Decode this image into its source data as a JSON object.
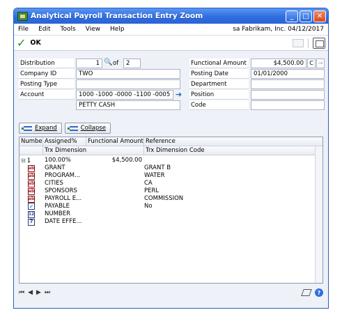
{
  "window": {
    "title": "Analytical Payroll Transaction Entry Zoom"
  },
  "menu": {
    "items": [
      "File",
      "Edit",
      "Tools",
      "View",
      "Help"
    ],
    "context": "sa  Fabrikam, Inc.  04/12/2017"
  },
  "toolbar": {
    "ok_label": "OK"
  },
  "fields": {
    "distribution": {
      "label": "Distribution",
      "value": "1",
      "of_label": "of",
      "total": "2"
    },
    "company_id": {
      "label": "Company ID",
      "value": "TWO"
    },
    "posting_type": {
      "label": "Posting Type",
      "value": ""
    },
    "account": {
      "label": "Account",
      "value": "1000 -1000 -0000 -1100 -0005",
      "description": "PETTY CASH"
    },
    "functional_amount": {
      "label": "Functional Amount",
      "value": "$4,500.00",
      "flag": "C"
    },
    "posting_date": {
      "label": "Posting Date",
      "value": "01/01/2000"
    },
    "department": {
      "label": "Department",
      "value": ""
    },
    "position": {
      "label": "Position",
      "value": ""
    },
    "code": {
      "label": "Code",
      "value": ""
    }
  },
  "buttons": {
    "expand": "Expand",
    "collapse": "Collapse"
  },
  "grid": {
    "headers": {
      "number": "Number",
      "assigned": "Assigned%",
      "functional_amount": "Functional Amount",
      "reference": "Reference",
      "trx_dimension": "Trx Dimension",
      "trx_dimension_code": "Trx Dimension Code"
    },
    "main_row": {
      "number": "1",
      "assigned": "100.00%",
      "amount": "$4,500.00"
    },
    "dimensions": [
      {
        "type": "ab",
        "name": "GRANT",
        "code": "GRANT B"
      },
      {
        "type": "ab",
        "name": "PROGRAM...",
        "code": "WATER"
      },
      {
        "type": "ab",
        "name": "CITIES",
        "code": "CA"
      },
      {
        "type": "ab",
        "name": "SPONSORS",
        "code": "PERL"
      },
      {
        "type": "ab",
        "name": "PAYROLL E...",
        "code": "COMMISSION"
      },
      {
        "type": "check",
        "name": "PAYABLE",
        "code": "No"
      },
      {
        "type": "number",
        "name": "NUMBER",
        "code": ""
      },
      {
        "type": "date",
        "name": "DATE EFFE...",
        "code": ""
      }
    ]
  }
}
